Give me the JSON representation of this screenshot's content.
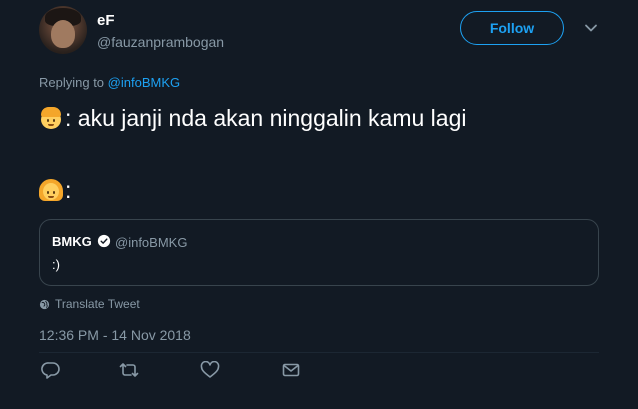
{
  "user": {
    "display_name": "eF",
    "handle": "@fauzanprambogan"
  },
  "follow_button": {
    "label": "Follow"
  },
  "reply_context": {
    "prefix": "Replying to",
    "mention": "@infoBMKG"
  },
  "tweet": {
    "line1": ": aku janji nda akan ninggalin kamu lagi",
    "line2": ":"
  },
  "quoted_tweet": {
    "name": "BMKG",
    "handle": "@infoBMKG",
    "text": ":)"
  },
  "translate_label": "Translate Tweet",
  "timestamp": "12:36 PM - 14 Nov 2018",
  "colors": {
    "background": "#121a24",
    "accent": "#1da1f2",
    "secondary_text": "#8899a6",
    "border": "#38444d"
  },
  "icons": {
    "line1_emoji": "man-emoji-icon",
    "line2_emoji": "woman-emoji-icon",
    "verified": "verified-badge-icon",
    "translate": "globe-icon",
    "reply": "reply-icon",
    "retweet": "retweet-icon",
    "like": "heart-icon",
    "message": "envelope-icon",
    "menu": "chevron-down-icon"
  }
}
